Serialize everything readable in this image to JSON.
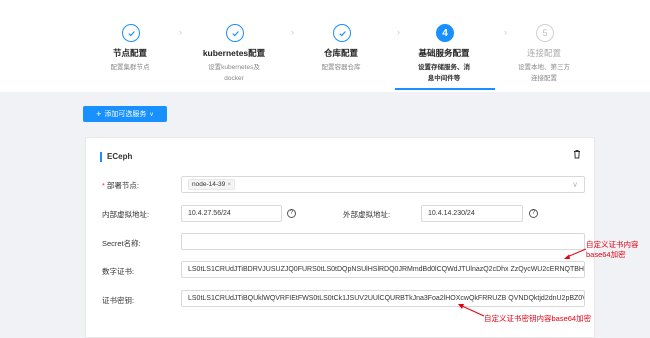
{
  "steps": [
    {
      "title": "节点配置",
      "desc": [
        "配置集群节点"
      ],
      "state": "done"
    },
    {
      "title": "kubernetes配置",
      "desc": [
        "设置kubernetes及",
        "docker"
      ],
      "state": "done"
    },
    {
      "title": "仓库配置",
      "desc": [
        "配置容器仓库"
      ],
      "state": "done"
    },
    {
      "title": "基础服务配置",
      "desc": [
        "设置存储服务、消",
        "息中间件等"
      ],
      "state": "active",
      "number": "4"
    },
    {
      "title": "连接配置",
      "desc": [
        "设置本地、第三方",
        "连接配置"
      ],
      "state": "pending",
      "number": "5"
    }
  ],
  "toolbar": {
    "add_service_label": "添加可选服务",
    "plus": "+",
    "chevron": "∨"
  },
  "card": {
    "title": "ECeph",
    "deploy_nodes_label": "部署节点:",
    "deploy_nodes_tag": "node-14-39",
    "tag_close": "×",
    "internal_vip_label": "内部虚拟地址:",
    "internal_vip_value": "10.4.27.56/24",
    "external_vip_label": "外部虚拟地址:",
    "external_vip_value": "10.4.14.230/24",
    "secret_name_label": "Secret名称:",
    "secret_name_value": "",
    "cert_label": "数字证书:",
    "cert_value": "LS0tLS1CRUdJTiBDRVJUSUZJQ0FURS0tLS0tDQpNSUlHSlRDQ0JRMmdBd0lCQWdJTUlnazQ2cDhx ZzQycWU2cERNQTBHQ1N",
    "key_label": "证书密钥:",
    "key_value": "LS0tLS1CRUdJTiBQUklWQVRFIEtFWS0tLS0tCk1JSUV2UUlCQURBTkJna3Foa2lHOXcwQkFRRUZB QVNDQktjd2dnU2pBZ0VBQ"
  },
  "annotations": {
    "cert_note_line1": "自定义证书内容",
    "cert_note_line2": "base64加密",
    "key_note": "自定义证书密钥内容base64加密"
  },
  "colors": {
    "primary": "#1890ff",
    "annotation": "#e60012"
  }
}
